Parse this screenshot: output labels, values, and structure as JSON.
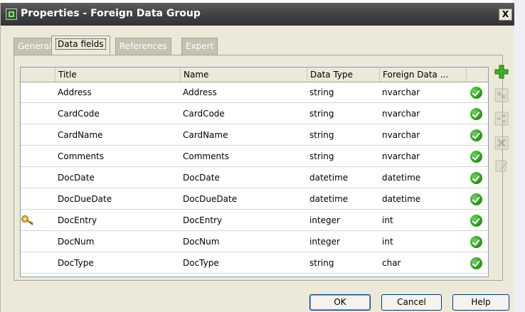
{
  "window": {
    "title": "Properties - Foreign Data Group",
    "close_label": "X"
  },
  "tabs": [
    {
      "label": "General",
      "active": false
    },
    {
      "label": "Data fields",
      "active": true
    },
    {
      "label": "References",
      "active": false
    },
    {
      "label": "Expert",
      "active": false
    }
  ],
  "grid": {
    "columns": [
      "Title",
      "Name",
      "Data Type",
      "Foreign Data ..."
    ],
    "rows": [
      {
        "title": "Address",
        "name": "Address",
        "data_type": "string",
        "foreign": "nvarchar",
        "key": false
      },
      {
        "title": "CardCode",
        "name": "CardCode",
        "data_type": "string",
        "foreign": "nvarchar",
        "key": false
      },
      {
        "title": "CardName",
        "name": "CardName",
        "data_type": "string",
        "foreign": "nvarchar",
        "key": false
      },
      {
        "title": "Comments",
        "name": "Comments",
        "data_type": "string",
        "foreign": "nvarchar",
        "key": false
      },
      {
        "title": "DocDate",
        "name": "DocDate",
        "data_type": "datetime",
        "foreign": "datetime",
        "key": false
      },
      {
        "title": "DocDueDate",
        "name": "DocDueDate",
        "data_type": "datetime",
        "foreign": "datetime",
        "key": false
      },
      {
        "title": "DocEntry",
        "name": "DocEntry",
        "data_type": "integer",
        "foreign": "int",
        "key": true
      },
      {
        "title": "DocNum",
        "name": "DocNum",
        "data_type": "integer",
        "foreign": "int",
        "key": false
      },
      {
        "title": "DocType",
        "name": "DocType",
        "data_type": "string",
        "foreign": "char",
        "key": false
      }
    ]
  },
  "side_tools": [
    {
      "icon": "add-icon",
      "enabled": true
    },
    {
      "icon": "link-icon",
      "enabled": false
    },
    {
      "icon": "hierarchy-icon",
      "enabled": false
    },
    {
      "icon": "delete-icon",
      "enabled": false
    },
    {
      "icon": "edit-icon",
      "enabled": false
    }
  ],
  "buttons": {
    "ok": "OK",
    "cancel": "Cancel",
    "help": "Help"
  },
  "colors": {
    "titlebar": "#3f3f41",
    "dialog_bg": "#ece9d8",
    "check_green": "#2e9a1e",
    "add_green": "#3fae2a"
  }
}
